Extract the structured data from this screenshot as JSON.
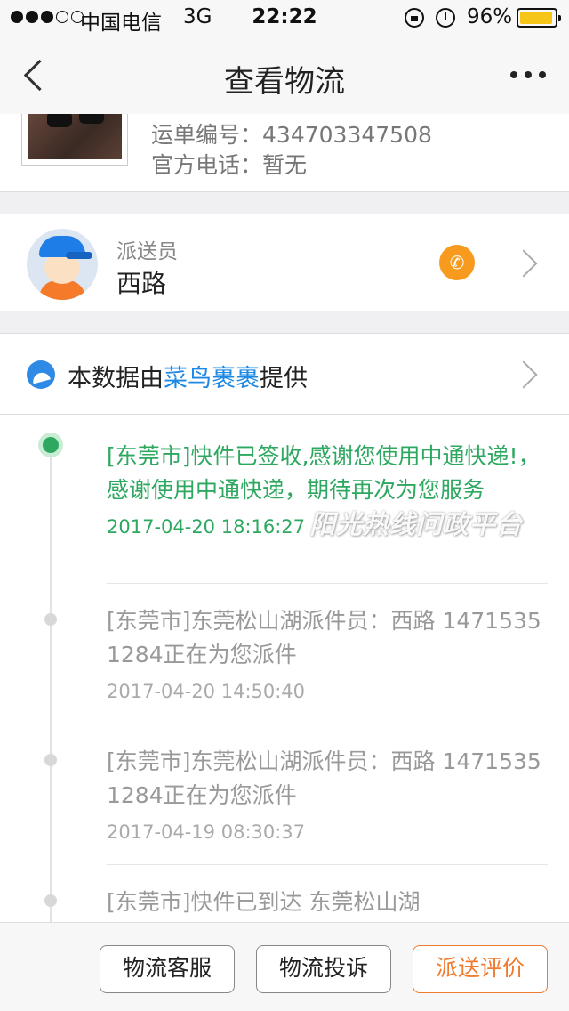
{
  "status_bar": {
    "carrier": "中国电信",
    "network": "3G",
    "time": "22:22",
    "battery_percent": "96%",
    "battery_level": 0.96,
    "signal_bars_filled": 3,
    "signal_bars_total": 5
  },
  "nav": {
    "title": "查看物流"
  },
  "package": {
    "waybill_label": "运单编号：",
    "waybill_number": "434703347508",
    "phone_label": "官方电话：",
    "phone_value": "暂无"
  },
  "courier": {
    "role": "派送员",
    "name": "西路"
  },
  "provider": {
    "prefix": "本数据由",
    "name": "菜鸟裹裹",
    "suffix": "提供"
  },
  "timeline": {
    "events": [
      {
        "text": "[东莞市]快件已签收,感谢您使用中通快递!，感谢使用中通快递，期待再次为您服务",
        "time": "2017-04-20 18:16:27"
      },
      {
        "text": "[东莞市]东莞松山湖派件员：西路 14715351284正在为您派件",
        "time": "2017-04-20 14:50:40"
      },
      {
        "text": "[东莞市]东莞松山湖派件员：西路 14715351284正在为您派件",
        "time": "2017-04-19 08:30:37"
      },
      {
        "text": "[东莞市]快件已到达 东莞松山湖",
        "time": ""
      }
    ]
  },
  "watermark": "阳光热线问政平台",
  "bottom_buttons": {
    "service": "物流客服",
    "complaint": "物流投诉",
    "review": "派送评价"
  },
  "colors": {
    "accent_green": "#2ea860",
    "link_blue": "#1e88e5",
    "phone_orange": "#f79a1e",
    "review_orange": "#f07a2e",
    "battery_yellow": "#f5c518"
  },
  "icons": [
    "back-chevron-icon",
    "more-dots-icon",
    "phone-icon",
    "chevron-right-icon",
    "cainiao-bird-icon",
    "lock-rotation-icon",
    "alarm-icon",
    "battery-icon"
  ]
}
